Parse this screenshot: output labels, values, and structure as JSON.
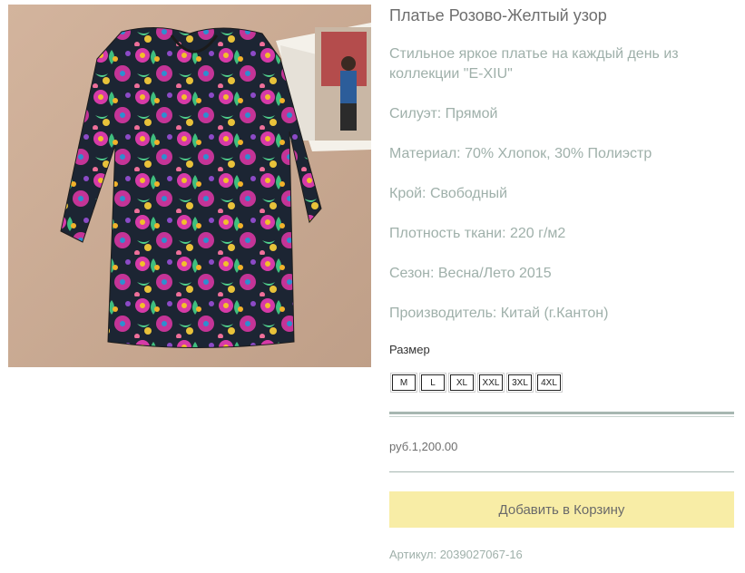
{
  "product": {
    "title": "Платье Розово-Желтый узор",
    "description": "Стильное яркое платье на каждый день из коллекции \"E-XIU\"",
    "attributes": [
      "Силуэт: Прямой",
      "Материал: 70% Хлопок, 30% Полиэстр",
      "Крой: Свободный",
      "Плотность ткани: 220 г/м2",
      "Сезон: Весна/Лето 2015",
      "Производитель: Китай (г.Кантон)"
    ],
    "size_label": "Размер",
    "sizes": [
      "M",
      "L",
      "XL",
      "XXL",
      "3XL",
      "4XL"
    ],
    "price": "руб.1,200.00",
    "add_to_cart_label": "Добавить в Корзину",
    "sku": "Артикул: 2039027067-16"
  },
  "colors": {
    "accent_button": "#f8eda6",
    "text_muted": "#9fb0aa",
    "divider": "#a7b7b1"
  }
}
